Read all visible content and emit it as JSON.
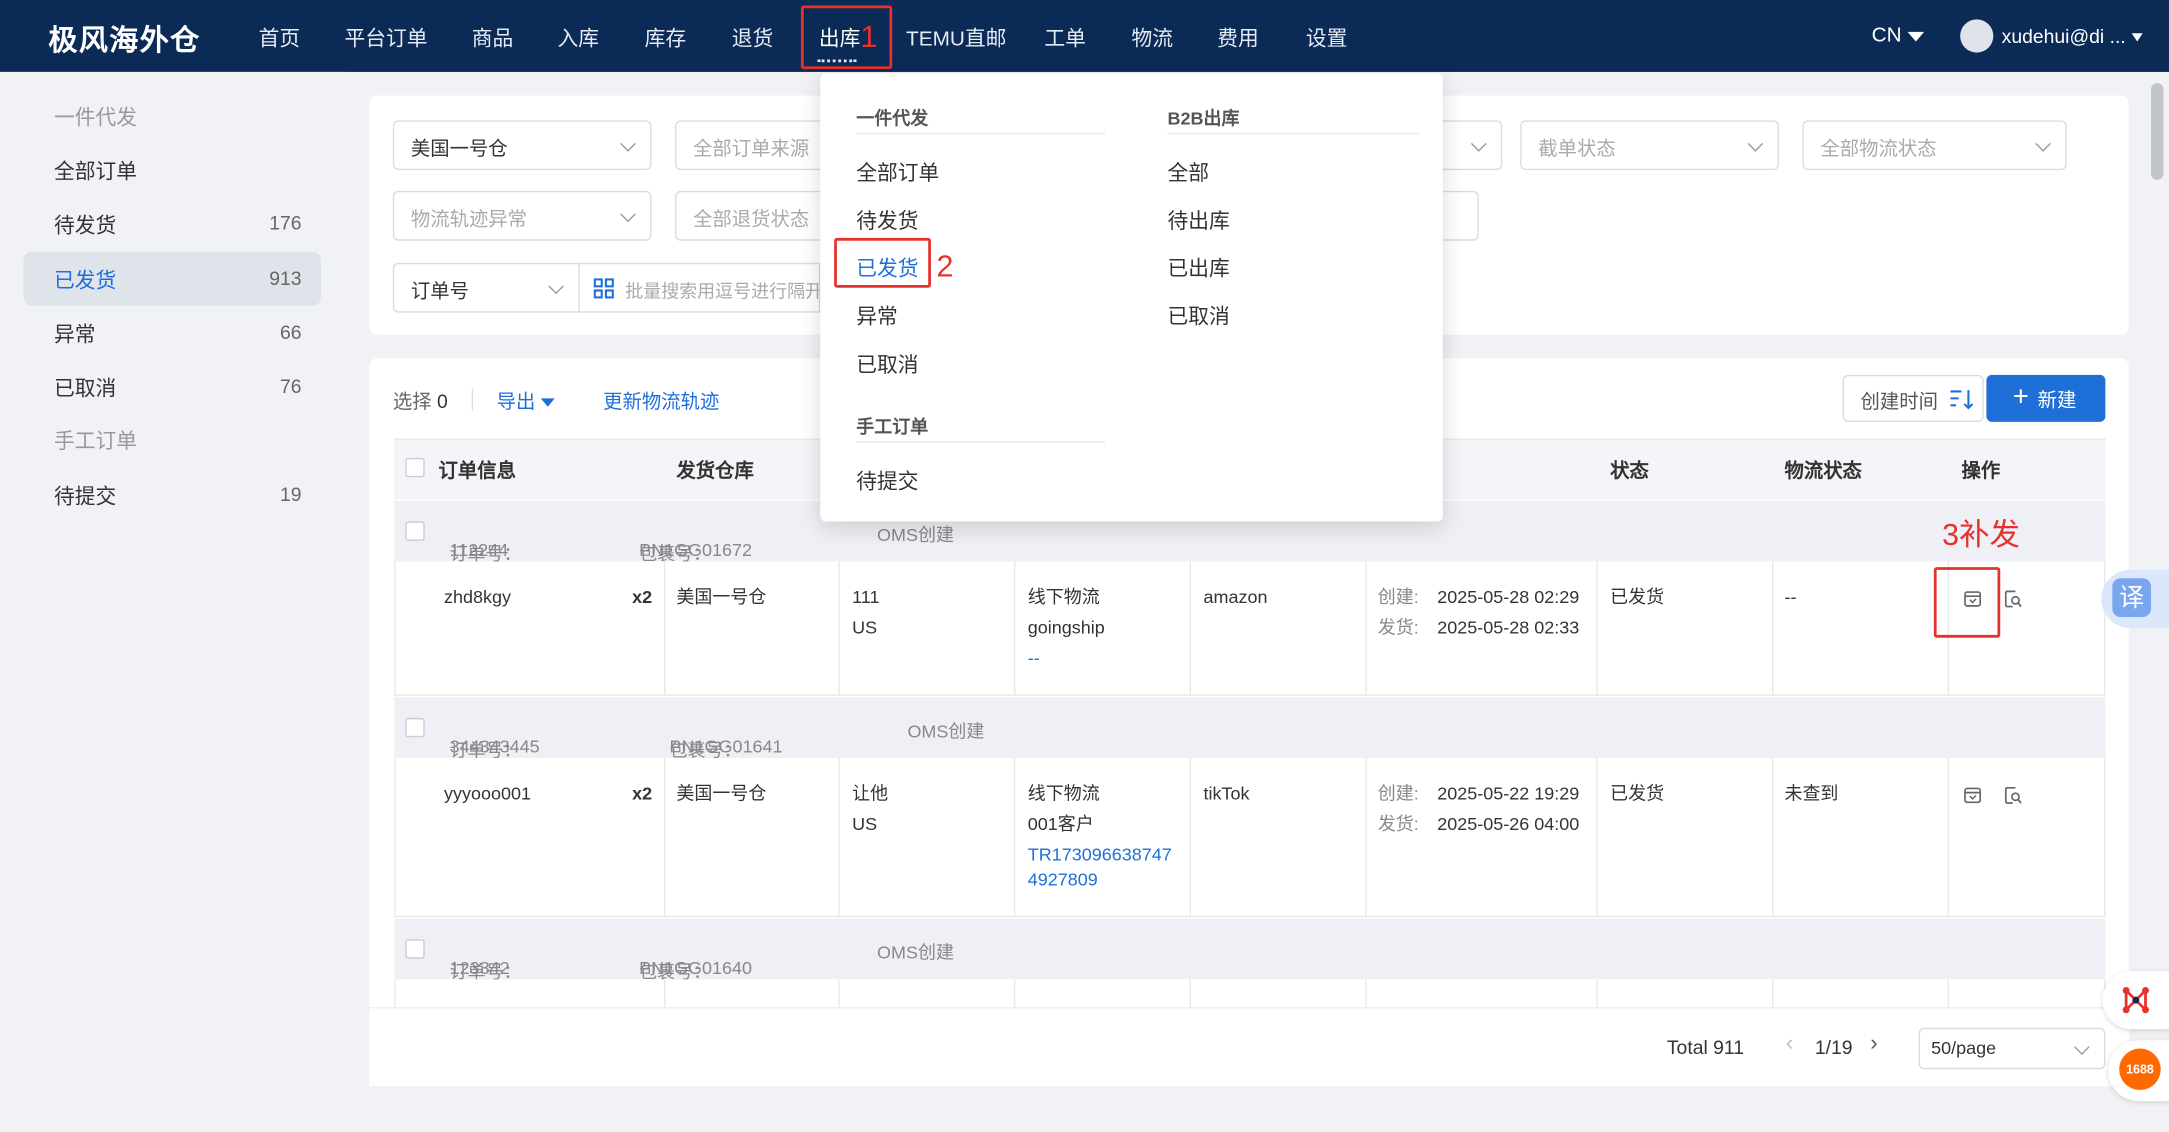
{
  "app": {
    "logo": "极风海外仓"
  },
  "nav": [
    {
      "label": "首页"
    },
    {
      "label": "平台订单"
    },
    {
      "label": "商品"
    },
    {
      "label": "入库"
    },
    {
      "label": "库存"
    },
    {
      "label": "退货"
    },
    {
      "label": "出库"
    },
    {
      "label": "TEMU直邮"
    },
    {
      "label": "工单"
    },
    {
      "label": "物流"
    },
    {
      "label": "费用"
    },
    {
      "label": "设置"
    }
  ],
  "header": {
    "lang": "CN",
    "user": "xudehui@di ..."
  },
  "annotations": {
    "step1": "1",
    "step2": "2",
    "step3": "3补发"
  },
  "sidebar": {
    "items": [
      {
        "label": "一件代发",
        "count": ""
      },
      {
        "label": "全部订单",
        "count": ""
      },
      {
        "label": "待发货",
        "count": "176"
      },
      {
        "label": "已发货",
        "count": "913"
      },
      {
        "label": "异常",
        "count": "66"
      },
      {
        "label": "已取消",
        "count": "76"
      },
      {
        "label": "手工订单",
        "count": ""
      },
      {
        "label": "待提交",
        "count": "19"
      }
    ]
  },
  "filters": {
    "warehouse": "美国一号仓",
    "order_source": "全部订单来源",
    "cutoff_status": "截单状态",
    "logistics_status": "全部物流状态",
    "track_exception": "物流轨迹异常",
    "return_status": "全部退货状态",
    "search_type": "订单号",
    "batch_search_placeholder": "批量搜索用逗号进行隔开"
  },
  "toolbar": {
    "select_label": "选择",
    "select_count": "0",
    "export": "导出",
    "update_tracking": "更新物流轨迹",
    "sort": "创建时间",
    "new": "新建"
  },
  "table": {
    "headers": {
      "order_info": "订单信息",
      "warehouse": "发货仓库",
      "status": "状态",
      "logistics_status": "物流状态",
      "ops": "操作"
    },
    "labels": {
      "order_no": "订单号：",
      "package_no": "包裹号：",
      "created": "创建:",
      "shipped": "发货:"
    },
    "orders": [
      {
        "order_no": "112244",
        "package_no": "PN1GG01672",
        "source": "OMS创建",
        "sku": "zhd8kgy",
        "qty": "x2",
        "warehouse": "美国一号仓",
        "recipient": "111",
        "country": "US",
        "carrier": "线下物流",
        "carrier_sub": "goingship",
        "tracking": "--",
        "platform": "amazon",
        "created": "2025-05-28 02:29",
        "shipped": "2025-05-28 02:33",
        "status": "已发货",
        "logistics": "--"
      },
      {
        "order_no": "344343445",
        "package_no": "PN1GG01641",
        "source": "OMS创建",
        "sku": "yyyooo001",
        "qty": "x2",
        "warehouse": "美国一号仓",
        "recipient": "让他",
        "country": "US",
        "carrier": "线下物流",
        "carrier_sub": "001客户",
        "tracking": "TR173096638747",
        "tracking2": "4927809",
        "platform": "tikTok",
        "created": "2025-05-22 19:29",
        "shipped": "2025-05-26 04:00",
        "status": "已发货",
        "logistics": "未查到"
      },
      {
        "order_no": "123342",
        "package_no": "PN1GG01640",
        "source": "OMS创建"
      }
    ]
  },
  "pagination": {
    "total": "Total 911",
    "page": "1/19",
    "per_page": "50/page"
  },
  "dropdown": {
    "col1_header": "一件代发",
    "col1_items": [
      "全部订单",
      "待发货",
      "已发货",
      "异常",
      "已取消"
    ],
    "col1_header2": "手工订单",
    "col1_items2": [
      "待提交"
    ],
    "col2_header": "B2B出库",
    "col2_items": [
      "全部",
      "待出库",
      "已出库",
      "已取消"
    ]
  },
  "floating": {
    "translate": "译",
    "alibaba": "1688"
  },
  "colors": {
    "topbar": "#0b2a55",
    "accent": "#1f6fd9",
    "annotation": "#e5322d"
  }
}
